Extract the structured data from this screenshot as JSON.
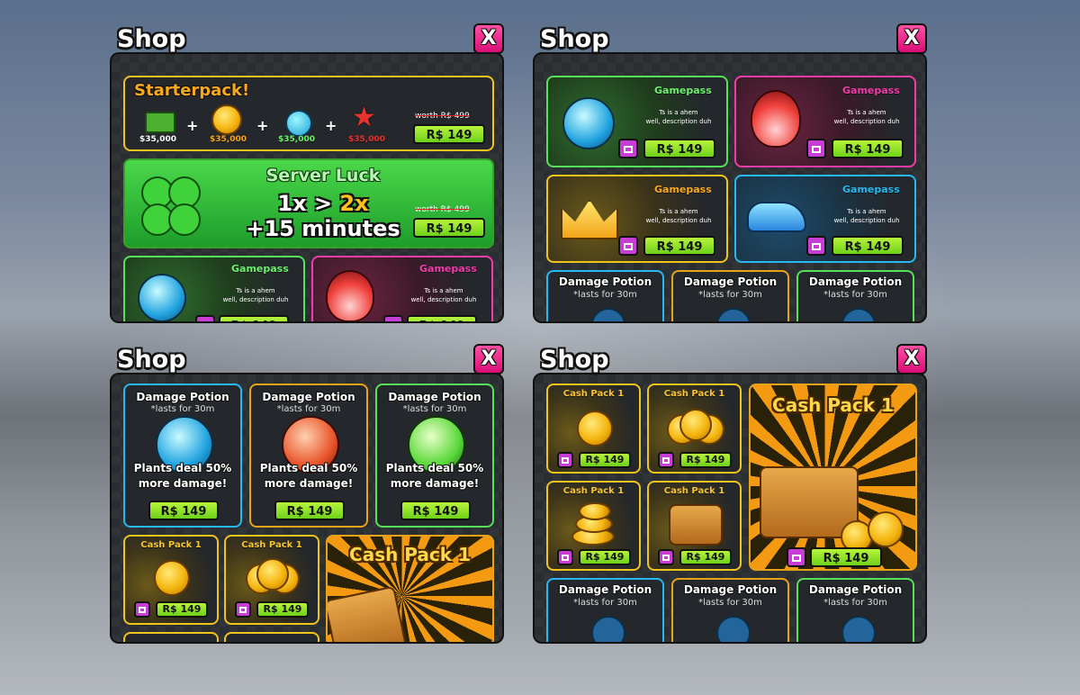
{
  "shop_title": "Shop",
  "close_label": "X",
  "price": "R$ 149",
  "starterpack": {
    "title": "Starterpack!",
    "items": [
      "$35,000",
      "$35,000",
      "$35,000",
      "$35,000"
    ],
    "worth": "worth R$ 499"
  },
  "server_luck": {
    "title": "Server Luck",
    "line1_a": "1x > ",
    "line1_b": "2x",
    "line2": "+15 minutes",
    "worth": "worth R$ 499"
  },
  "gamepass": {
    "label": "Gamepass",
    "desc1": "Ts is a ahem",
    "desc2": "well, description duh"
  },
  "damage_potion": {
    "name": "Damage Potion",
    "duration": "*lasts for 30m",
    "effect1": "Plants deal 50%",
    "effect2": "more damage!"
  },
  "cash_pack": {
    "name": "Cash Pack 1"
  },
  "colors": {
    "green": "#57e05a",
    "pink": "#f13ba9",
    "yellow": "#f0c419",
    "blue": "#27b8f0",
    "price_bg": "#9ee52b",
    "close_bg": "#e8167f"
  }
}
